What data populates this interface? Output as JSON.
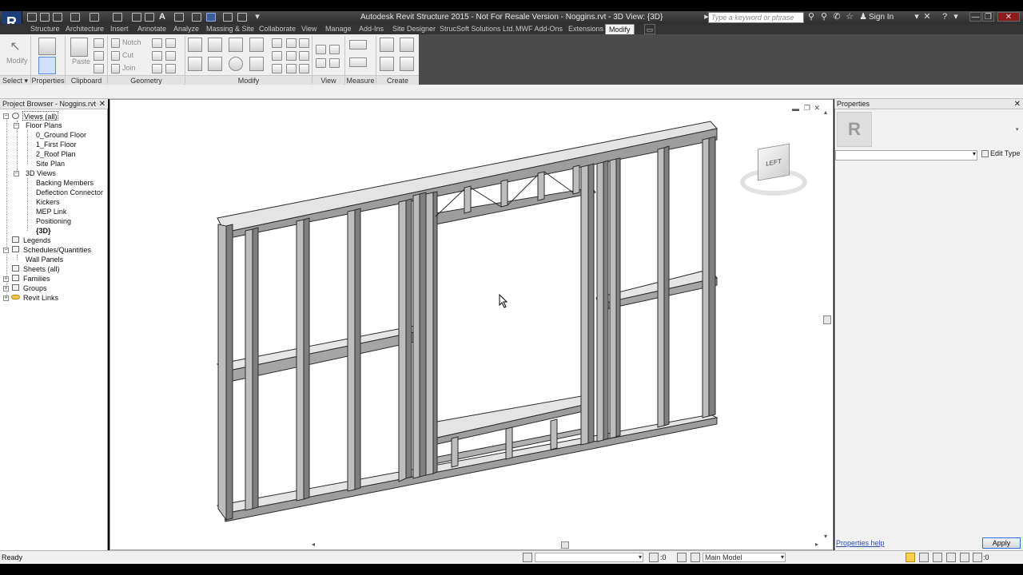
{
  "app": {
    "logo_letter": "R",
    "title": "Autodesk Revit Structure 2015 - Not For Resale Version -    Noggins.rvt - 3D View: {3D}",
    "search_placeholder": "Type a keyword or phrase",
    "sign_in": "Sign In"
  },
  "tabs": [
    {
      "label": "Structure"
    },
    {
      "label": "Architecture"
    },
    {
      "label": "Insert"
    },
    {
      "label": "Annotate"
    },
    {
      "label": "Analyze"
    },
    {
      "label": "Massing & Site"
    },
    {
      "label": "Collaborate"
    },
    {
      "label": "View"
    },
    {
      "label": "Manage"
    },
    {
      "label": "Add-Ins"
    },
    {
      "label": "Site Designer"
    },
    {
      "label": "StrucSoft Solutions Ltd."
    },
    {
      "label": "MWF Add-Ons"
    },
    {
      "label": "Extensions"
    },
    {
      "label": "Modify"
    }
  ],
  "ribbon": {
    "modify_label": "Modify",
    "paste_label": "Paste",
    "notch_label": "Notch",
    "cut_label": "Cut",
    "join_label": "Join",
    "panels": {
      "select": "Select",
      "properties": "Properties",
      "clipboard": "Clipboard",
      "geometry": "Geometry",
      "modify": "Modify",
      "view": "View",
      "measure": "Measure",
      "create": "Create"
    }
  },
  "project_browser": {
    "title": "Project Browser - Noggins.rvt",
    "items": [
      {
        "label": "Views (all)"
      },
      {
        "label": "Floor Plans"
      },
      {
        "label": "0_Ground Floor"
      },
      {
        "label": "1_First Floor"
      },
      {
        "label": "2_Roof Plan"
      },
      {
        "label": "Site Plan"
      },
      {
        "label": "3D Views"
      },
      {
        "label": "Backing Members"
      },
      {
        "label": "Deflection Connector"
      },
      {
        "label": "Kickers"
      },
      {
        "label": "MEP Link"
      },
      {
        "label": "Positioning"
      },
      {
        "label": "{3D}"
      },
      {
        "label": "Legends"
      },
      {
        "label": "Schedules/Quantities"
      },
      {
        "label": "Wall Panels"
      },
      {
        "label": "Sheets (all)"
      },
      {
        "label": "Families"
      },
      {
        "label": "Groups"
      },
      {
        "label": "Revit Links"
      }
    ]
  },
  "viewcube": {
    "face_label": "LEFT"
  },
  "properties": {
    "title": "Properties",
    "edit_type": "Edit Type",
    "help_link": "Properties help",
    "apply": "Apply"
  },
  "status": {
    "text": "Ready",
    "count": ":0",
    "workset": "Main Model",
    "filter_count": ":0"
  }
}
